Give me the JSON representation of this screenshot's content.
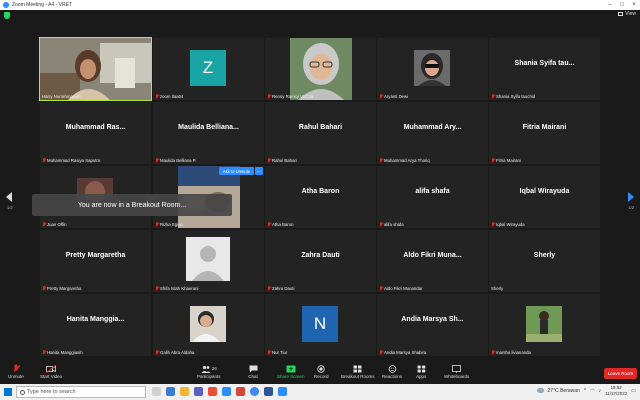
{
  "window": {
    "title": "Zoom Meeting - A4 - VRET",
    "view_label": "View"
  },
  "tiles": [
    {
      "id": "t1",
      "bigname": "",
      "label": "Harry Nurrahmawati",
      "muted": false
    },
    {
      "id": "t2",
      "bigname": "",
      "label": "zoom tlaa04",
      "muted": true,
      "letter": "Z",
      "letter_color": "#1aa3a3"
    },
    {
      "id": "t3",
      "bigname": "",
      "label": "Renny Ramsy VI/Cha",
      "muted": true
    },
    {
      "id": "t4",
      "bigname": "",
      "label": "Aryanti Dewi",
      "muted": true
    },
    {
      "id": "t5",
      "bigname": "Shania Syifa tau...",
      "label": "Shania Syifa tauchid",
      "muted": true
    },
    {
      "id": "t6",
      "bigname": "Muhammad Ras...",
      "label": "Muhammad Rasiya Saputra",
      "muted": true
    },
    {
      "id": "t7",
      "bigname": "Maulida Belliana...",
      "label": "Maulida Belliana P.",
      "muted": true
    },
    {
      "id": "t8",
      "bigname": "Rahul Bahari",
      "label": "Rahul Bahari",
      "muted": true
    },
    {
      "id": "t9",
      "bigname": "Muhammad Ary...",
      "label": "Muhammad Arya Thoriq",
      "muted": true
    },
    {
      "id": "t10",
      "bigname": "Fitria Mairani",
      "label": "Fitria Mairani",
      "muted": true
    },
    {
      "id": "t11",
      "bigname": "",
      "label": "Juan Offin",
      "muted": true
    },
    {
      "id": "t12",
      "bigname": "",
      "label": "Rizka Egian",
      "muted": true
    },
    {
      "id": "t13",
      "bigname": "Atha Baron",
      "label": "Atha Baron",
      "muted": true
    },
    {
      "id": "t14",
      "bigname": "alifa shafa",
      "label": "alifa shafa",
      "muted": true
    },
    {
      "id": "t15",
      "bigname": "Iqbal Wirayuda",
      "label": "Iqbal Wirayuda",
      "muted": true
    },
    {
      "id": "t16",
      "bigname": "Pretty Margaretha",
      "label": "Pretty Margaretha",
      "muted": true
    },
    {
      "id": "t17",
      "bigname": "",
      "label": "Shifa Islah Khaerani",
      "muted": true
    },
    {
      "id": "t18",
      "bigname": "Zahra Dauti",
      "label": "Zahra Dauti",
      "muted": true
    },
    {
      "id": "t19",
      "bigname": "Aldo Fikri Muna...",
      "label": "Aldo Fikri Munandar",
      "muted": true
    },
    {
      "id": "t20",
      "bigname": "Sherly",
      "label": "Sherly",
      "muted": false
    },
    {
      "id": "t21",
      "bigname": "Hanita Manggia...",
      "label": "Hanita Manggiasih",
      "muted": true
    },
    {
      "id": "t22",
      "bigname": "",
      "label": "Galih Abra Aldaha",
      "muted": true
    },
    {
      "id": "t23",
      "bigname": "",
      "label": "Nur Tiur",
      "muted": true,
      "letter": "N",
      "letter_color": "#1f64b0"
    },
    {
      "id": "t24",
      "bigname": "Andia Marsya Sh...",
      "label": "Andia Marsya Shabira",
      "muted": true
    },
    {
      "id": "t25",
      "bigname": "",
      "label": "marsha livianandа",
      "muted": true
    }
  ],
  "overlay": {
    "toast": "You are now in a Breakout Room...",
    "ask_to_unmute": "Ask to Unmute",
    "more": "...",
    "page_left": "1/2",
    "page_right": "1/2"
  },
  "toolbar": {
    "unmute": "Unmute",
    "start_video": "Start Video",
    "participants": "Participants",
    "participants_count": "26",
    "chat": "Chat",
    "share_screen": "Share Screen",
    "record": "Record",
    "breakout_rooms": "Breakout Rooms",
    "reactions": "Reactions",
    "apps": "Apps",
    "whiteboards": "Whiteboards",
    "leave": "Leave Room"
  },
  "taskbar": {
    "search_placeholder": "Type here to search",
    "weather": "27°C  Berawan",
    "time": "18:52",
    "date": "11/17/2022"
  },
  "colors": {
    "share_green": "#23d959",
    "leave_red": "#e02828",
    "active_border": "#b3e542",
    "zoom_blue": "#2d8cff"
  }
}
